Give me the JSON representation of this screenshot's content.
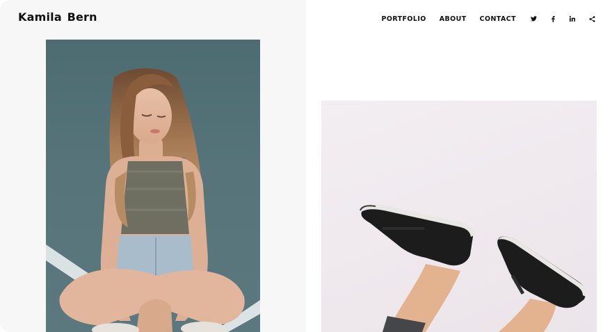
{
  "site": {
    "brand": "Kamila Bern"
  },
  "nav": {
    "items": [
      {
        "label": "PORTFOLIO"
      },
      {
        "label": "ABOUT"
      },
      {
        "label": "CONTACT"
      }
    ],
    "social": [
      "twitter-icon",
      "facebook-icon",
      "linkedin-icon",
      "share-icon"
    ]
  },
  "gallery": {
    "photos": [
      {
        "name": "girl-sitting-on-court-photo"
      },
      {
        "name": "black-sneakers-photo"
      }
    ]
  },
  "colors": {
    "left_panel_bg": "#f7f7f8",
    "text": "#111111",
    "court": "#56747a",
    "sneaker_bg": "#efe9ee"
  }
}
